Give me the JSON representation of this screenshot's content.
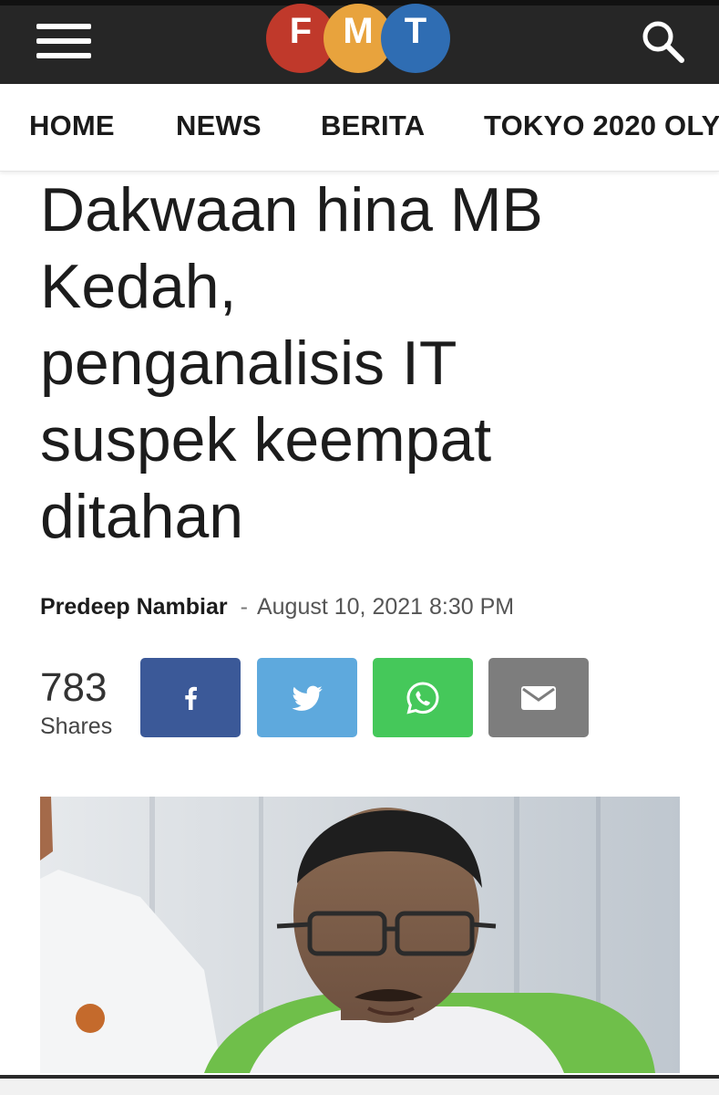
{
  "logo": {
    "letters": [
      "F",
      "M",
      "T"
    ],
    "colors": [
      "#c0392b",
      "#e8a33d",
      "#2f6db3"
    ]
  },
  "header": {
    "menu_icon": "hamburger-menu-icon",
    "search_icon": "search-icon",
    "background": "#262626"
  },
  "nav": {
    "items": [
      {
        "label": "HOME"
      },
      {
        "label": "NEWS"
      },
      {
        "label": "BERITA"
      },
      {
        "label": "TOKYO 2020 OLY"
      }
    ]
  },
  "article": {
    "headline_lines": [
      "Dakwaan hina MB",
      "Kedah,",
      "penganalisis IT",
      "suspek keempat",
      "ditahan"
    ],
    "author": "Predeep Nambiar",
    "separator": "-",
    "date": "August 10, 2021 8:30 PM"
  },
  "share": {
    "count": "783",
    "label": "Shares",
    "buttons": [
      {
        "name": "facebook",
        "icon": "facebook-icon",
        "color": "#3b5998"
      },
      {
        "name": "twitter",
        "icon": "twitter-icon",
        "color": "#5ea9dd"
      },
      {
        "name": "whatsapp",
        "icon": "whatsapp-icon",
        "color": "#45c85a"
      },
      {
        "name": "email",
        "icon": "mail-icon",
        "color": "#7d7d7d"
      }
    ]
  },
  "photo": {
    "subject": "man-with-glasses-photo"
  }
}
